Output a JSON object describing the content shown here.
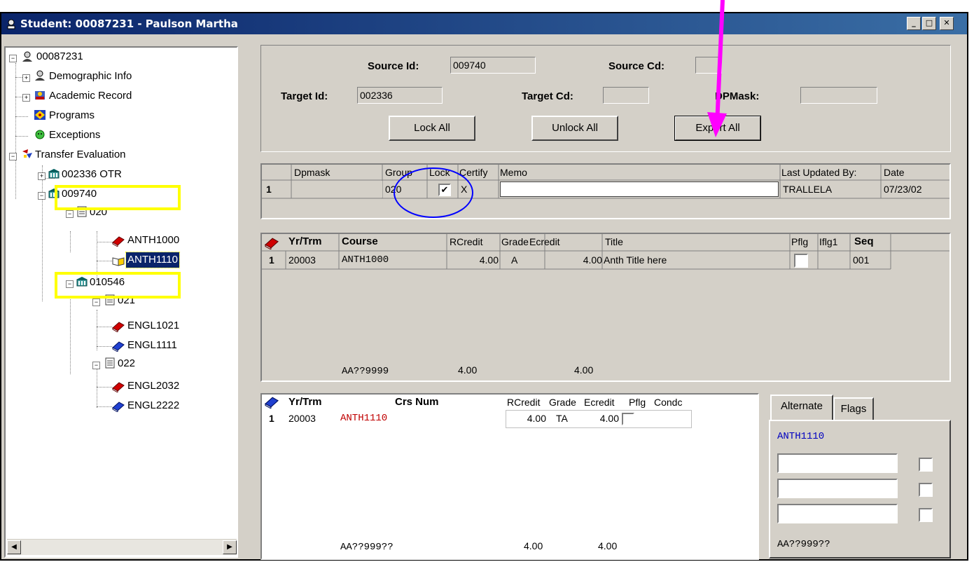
{
  "window": {
    "title": "Student: 00087231 - Paulson Martha",
    "minimize_glyph": "_",
    "maximize_glyph": "□",
    "close_glyph": "✕"
  },
  "tree": {
    "root": "00087231",
    "demographic": "Demographic Info",
    "academic": "Academic Record",
    "programs": "Programs",
    "exceptions": "Exceptions",
    "transfer": "Transfer Evaluation",
    "inst1": "002336   OTR",
    "inst2": "009740",
    "inst2_group": "020",
    "inst2_course1": "ANTH1000",
    "inst2_course2": "ANTH1110",
    "inst3": "010546",
    "inst3_group1": "021",
    "inst3_group1_course1": "ENGL1021",
    "inst3_group1_course2": "ENGL1111",
    "inst3_group2": "022",
    "inst3_group2_course1": "ENGL2032",
    "inst3_group2_course2": "ENGL2222"
  },
  "header_form": {
    "source_id_label": "Source Id:",
    "source_id_value": "009740",
    "source_cd_label": "Source Cd:",
    "source_cd_value": "",
    "target_id_label": "Target Id:",
    "target_id_value": "002336",
    "target_cd_label": "Target Cd:",
    "target_cd_value": "",
    "dpmask_label": "DPMask:",
    "dpmask_value": "",
    "lock_all": "Lock All",
    "unlock_all": "Unlock All",
    "export_all": "Export All"
  },
  "group_grid": {
    "headers": [
      "Dpmask",
      "Group",
      "Lock",
      "Certify",
      "Memo",
      "Last Updated By:",
      "Date"
    ],
    "row": {
      "num": "1",
      "dpmask": "",
      "group": "020",
      "lock": true,
      "certify": "X",
      "memo": "",
      "updated_by": "TRALLELA",
      "date": "07/23/02"
    }
  },
  "source_grid": {
    "headers": [
      "Yr/Trm",
      "Course",
      "RCredit",
      "Grade",
      "Ecredit",
      "Title",
      "Pflg",
      "Iflg1",
      "Seq"
    ],
    "row": {
      "num": "1",
      "yrtrm": "20003",
      "course": "ANTH1000",
      "rcredit": "4.00",
      "grade": "A",
      "ecredit": "4.00",
      "title": "Anth Title here",
      "pflg": false,
      "iflg1": "",
      "seq": "001"
    },
    "footer": {
      "mask": "AA??9999",
      "rcredit": "4.00",
      "ecredit": "4.00"
    }
  },
  "target_grid": {
    "headers": [
      "Yr/Trm",
      "Crs Num",
      "RCredit",
      "Grade",
      "Ecredit",
      "Pflg",
      "Condc"
    ],
    "row": {
      "num": "1",
      "yrtrm": "20003",
      "crsnum": "ANTH1110",
      "rcredit": "4.00",
      "grade": "TA",
      "ecredit": "4.00",
      "pflg": false,
      "condc": ""
    },
    "footer": {
      "mask": "AA??999??",
      "rcredit": "4.00",
      "ecredit": "4.00"
    }
  },
  "alt_panel": {
    "tabs": [
      "Alternate",
      "Flags"
    ],
    "course": "ANTH1110",
    "inputs": [
      "",
      "",
      ""
    ],
    "footer": "AA??999??"
  },
  "colors": {
    "annotation_arrow": "#ff00ff",
    "highlight_box": "#ffff00",
    "circle": "#0000ff",
    "titlebar": "#0a246a",
    "selection": "#0a246a",
    "target_course": "#c00000",
    "alt_course": "#0000c0"
  }
}
